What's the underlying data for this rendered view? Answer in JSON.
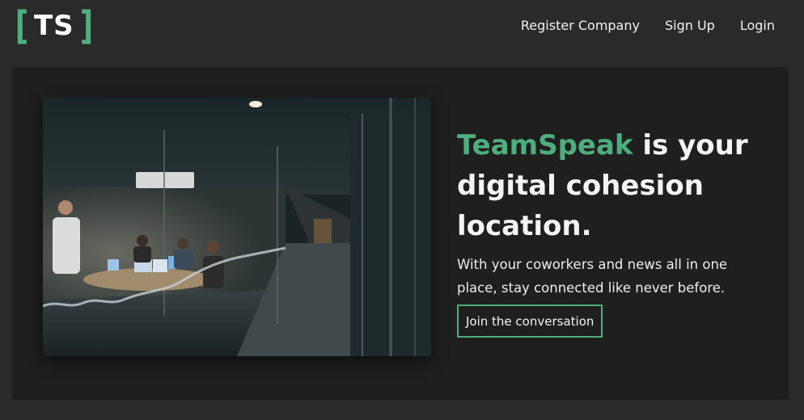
{
  "logo": {
    "left_bracket": "[",
    "letters": "TS",
    "right_bracket": "]"
  },
  "nav": {
    "links": [
      {
        "label": "Register Company"
      },
      {
        "label": "Sign Up"
      },
      {
        "label": "Login"
      }
    ]
  },
  "hero": {
    "headline_brand": "TeamSpeak",
    "headline_rest": " is your digital cohesion location.",
    "subtext": "With your coworkers and news all in one place, stay connected like never before.",
    "cta_label": "Join the conversation",
    "image_icon": "office-meeting-photo"
  },
  "colors": {
    "accent": "#4caf7d",
    "page_bg": "#2a2a2a",
    "hero_bg": "#1f1f1f"
  }
}
